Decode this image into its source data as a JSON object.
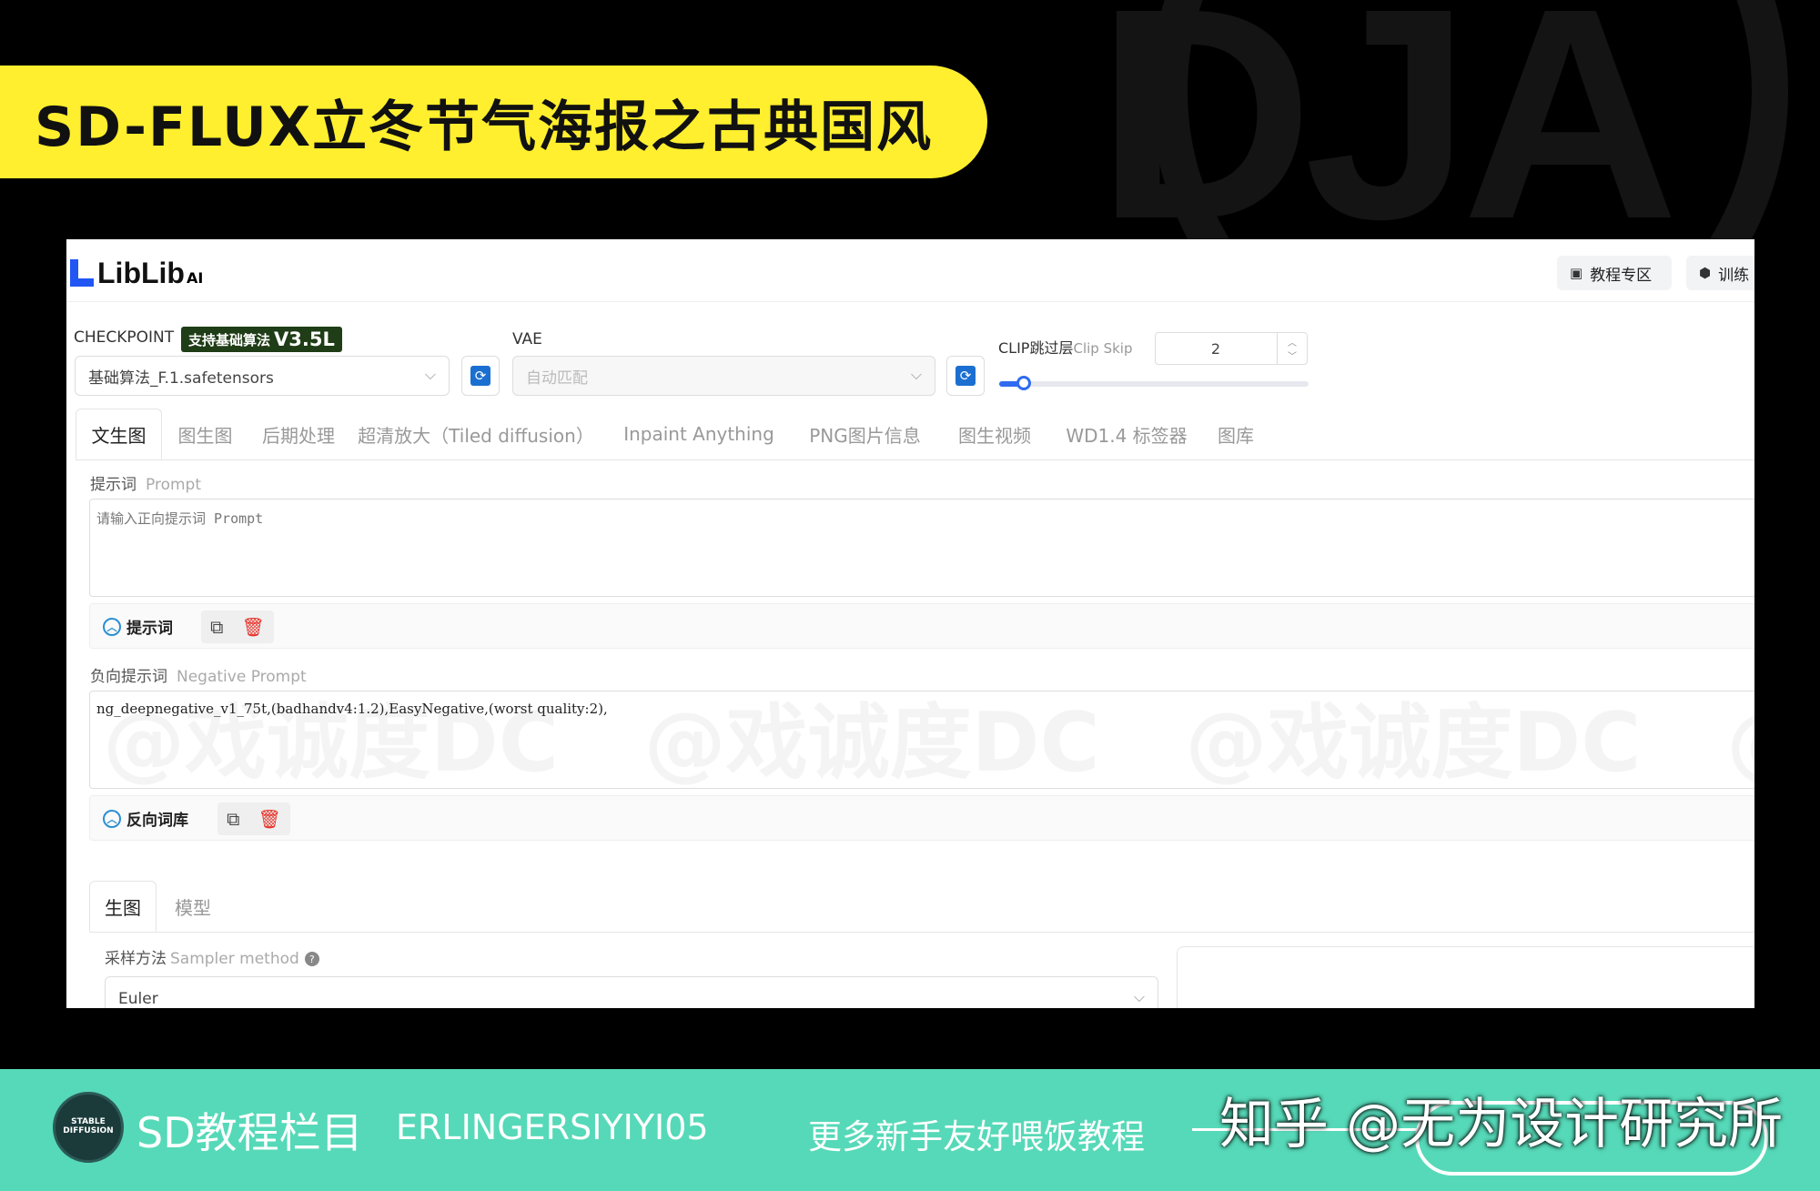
{
  "banner": {
    "title": "SD-FLUX立冬节气海报之古典国风"
  },
  "app": {
    "logo": "LibLib",
    "logo_sup": "AI",
    "top_buttons": [
      {
        "icon": "play-square-icon",
        "label": "教程专区"
      },
      {
        "icon": "cube-icon",
        "label": "训练"
      }
    ]
  },
  "checkpoint": {
    "label": "CHECKPOINT",
    "badge_prefix": "支持基础算法",
    "badge_version": "V3.5L",
    "value": "基础算法_F.1.safetensors"
  },
  "vae": {
    "label": "VAE",
    "value": "自动匹配"
  },
  "clip": {
    "label": "CLIP跳过层",
    "label_en": "Clip Skip",
    "value": "2",
    "slider_fraction": 0.08
  },
  "tabs": [
    {
      "label": "文生图",
      "active": true
    },
    {
      "label": "图生图"
    },
    {
      "label": "后期处理"
    },
    {
      "label": "超清放大（Tiled diffusion）"
    },
    {
      "label": "Inpaint Anything"
    },
    {
      "label": "PNG图片信息"
    },
    {
      "label": "图生视频"
    },
    {
      "label": "WD1.4 标签器"
    },
    {
      "label": "图库"
    }
  ],
  "prompt": {
    "label": "提示词",
    "label_en": "Prompt",
    "placeholder": "请输入正向提示词 Prompt",
    "toggle_label": "提示词"
  },
  "negative": {
    "label": "负向提示词",
    "label_en": "Negative Prompt",
    "value": "ng_deepnegative_v1_75t,(badhandv4:1.2),EasyNegative,(worst quality:2),",
    "toggle_label": "反向词库"
  },
  "subtabs": [
    {
      "label": "生图",
      "active": true
    },
    {
      "label": "模型"
    }
  ],
  "sampler": {
    "label": "采样方法",
    "label_en": "Sampler method",
    "value": "Euler"
  },
  "footer": {
    "logo_text": "STABLE DIFFUSION",
    "column": "SD教程栏目",
    "code": "ERLINGERSIYIYI05",
    "slogan": "更多新手友好喂饭教程",
    "zhihu": "知乎 @无为设计研究所"
  },
  "colors": {
    "banner": "#ffef2e",
    "footer": "#56d9b8",
    "accent": "#2f6bf0"
  }
}
